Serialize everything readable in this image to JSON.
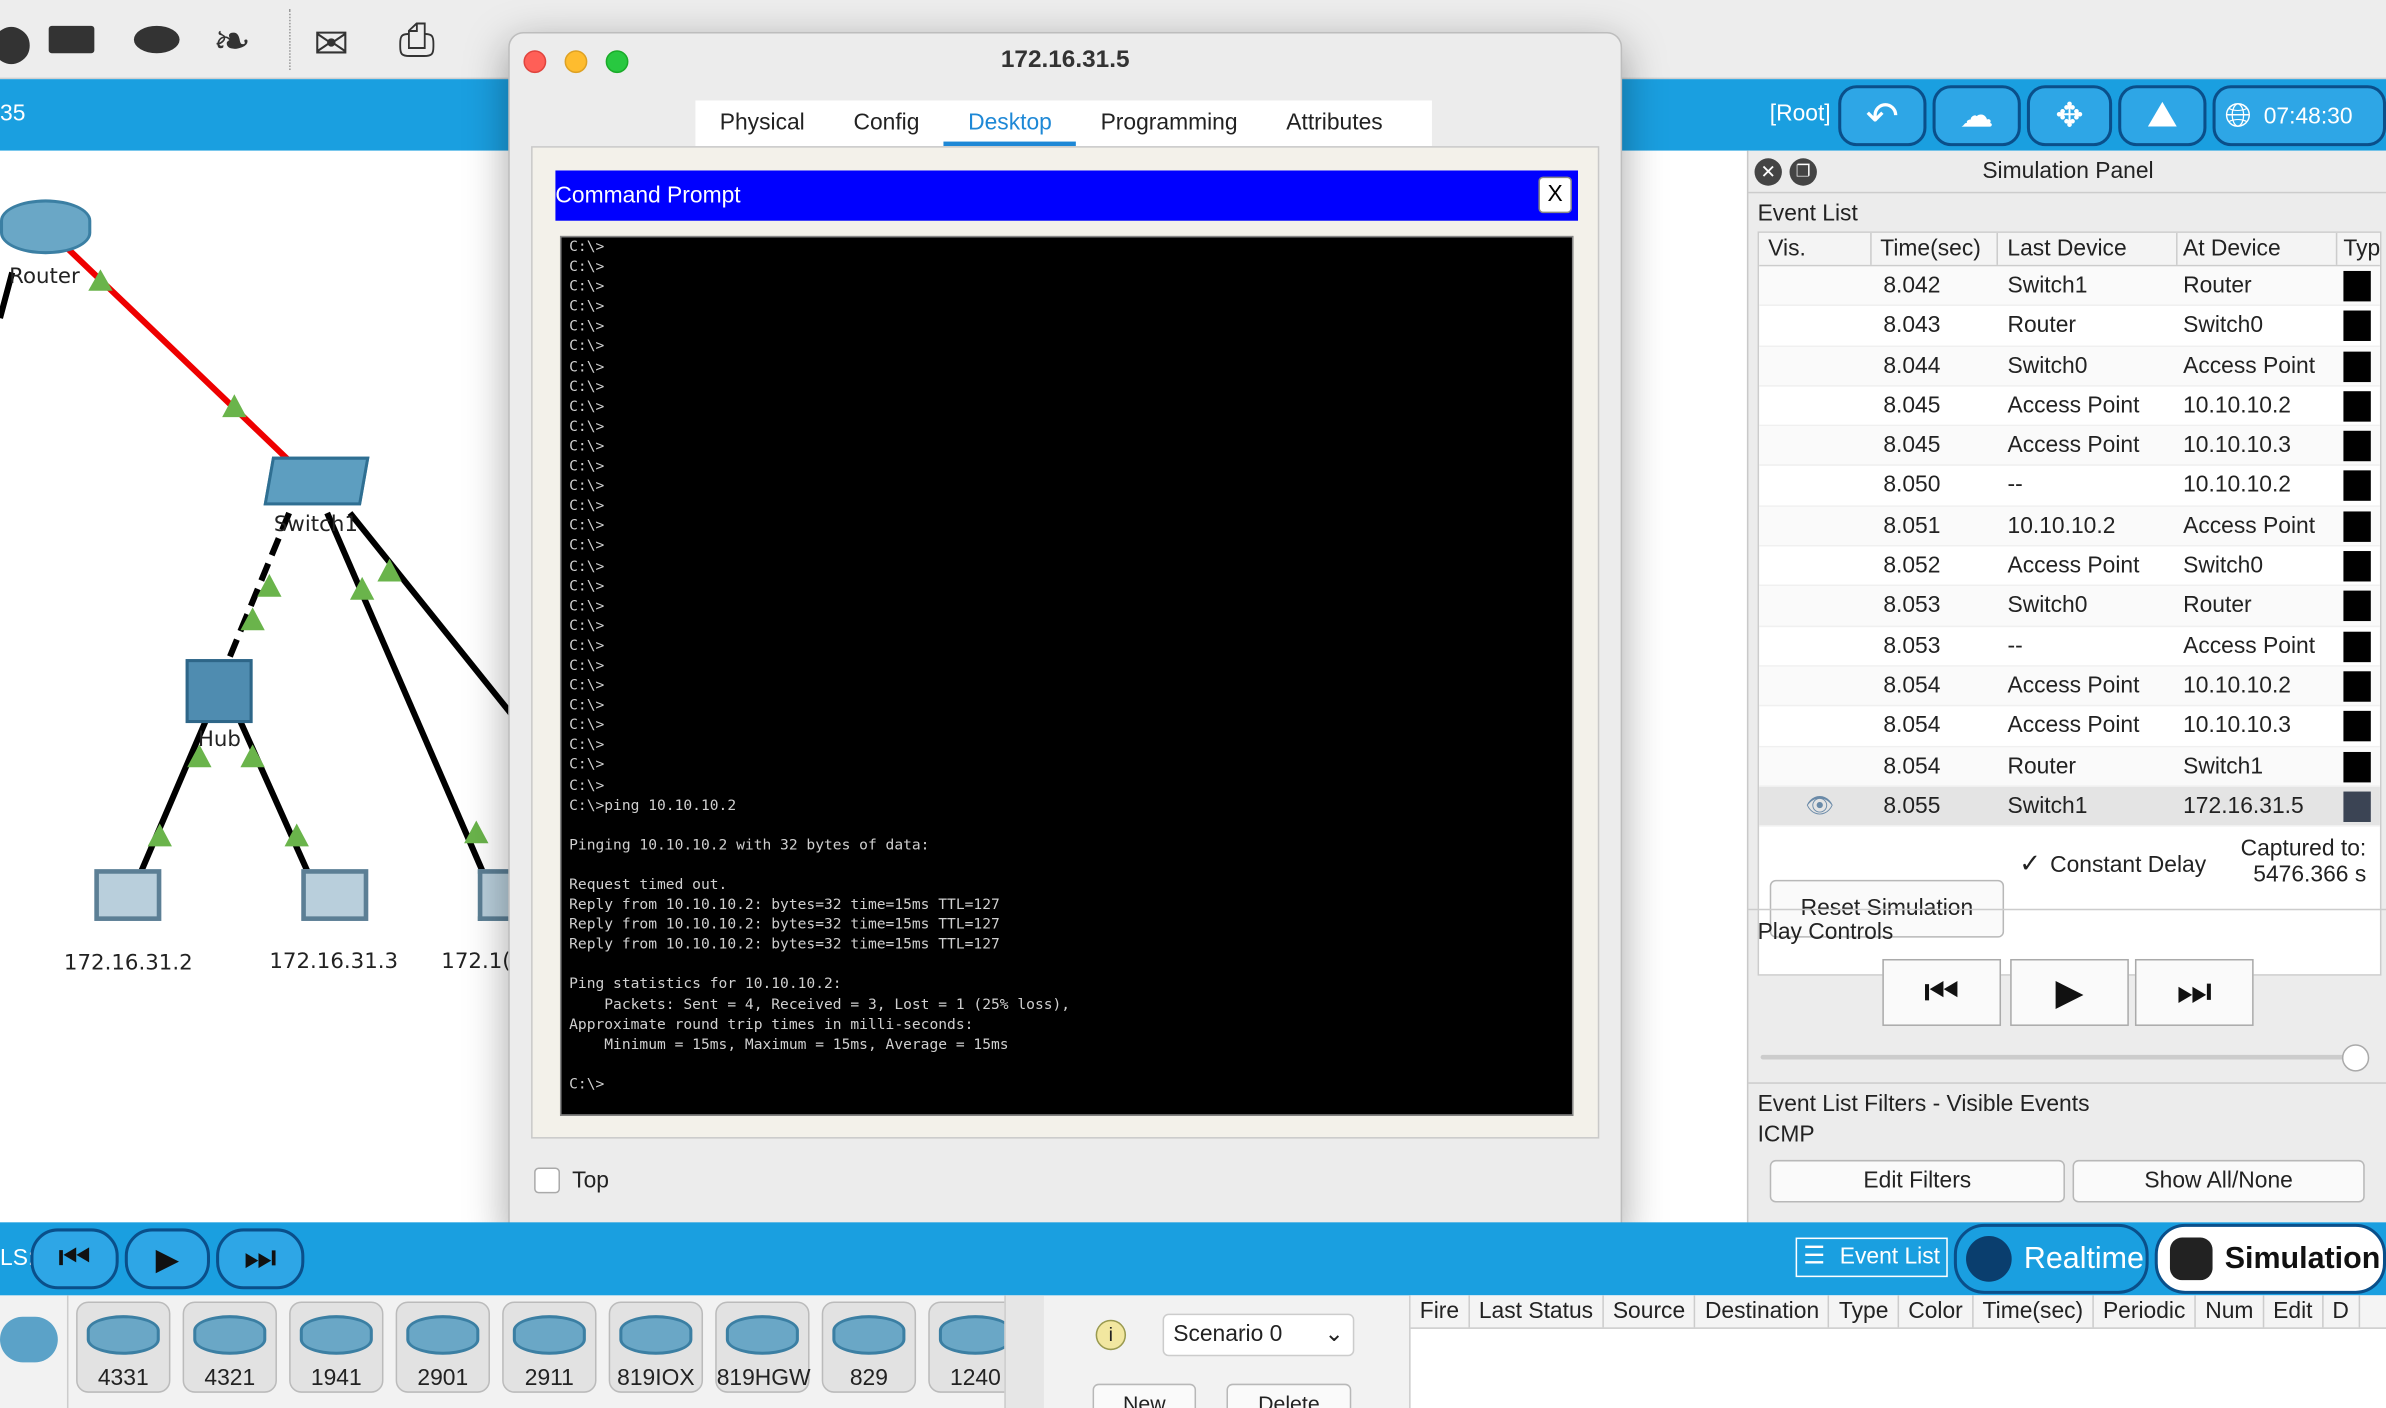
{
  "window": {
    "title": "172.16.31.5",
    "tabs": [
      "Physical",
      "Config",
      "Desktop",
      "Programming",
      "Attributes"
    ],
    "active_tab": "Desktop",
    "top_checkbox_label": "Top"
  },
  "command_prompt": {
    "title": "Command Prompt",
    "close": "X",
    "output": "C:\\>\nC:\\>\nC:\\>\nC:\\>\nC:\\>\nC:\\>\nC:\\>\nC:\\>\nC:\\>\nC:\\>\nC:\\>\nC:\\>\nC:\\>\nC:\\>\nC:\\>\nC:\\>\nC:\\>\nC:\\>\nC:\\>\nC:\\>\nC:\\>\nC:\\>\nC:\\>\nC:\\>\nC:\\>\nC:\\>\nC:\\>\nC:\\>\nC:\\>ping 10.10.10.2\n\nPinging 10.10.10.2 with 32 bytes of data:\n\nRequest timed out.\nReply from 10.10.10.2: bytes=32 time=15ms TTL=127\nReply from 10.10.10.2: bytes=32 time=15ms TTL=127\nReply from 10.10.10.2: bytes=32 time=15ms TTL=127\n\nPing statistics for 10.10.10.2:\n    Packets: Sent = 4, Received = 3, Lost = 1 (25% loss),\nApproximate round trip times in milli-seconds:\n    Minimum = 15ms, Maximum = 15ms, Average = 15ms\n\nC:\\>"
  },
  "bluebar": {
    "left_fragment": "35",
    "root_label": "[Root]",
    "clock": "07:48:30"
  },
  "topology": {
    "labels": {
      "router": "Router",
      "switch": "Switch1",
      "hub": "Hub",
      "pc1": "172.16.31.2",
      "pc2": "172.16.31.3",
      "pc3": "172.1("
    }
  },
  "sim_panel": {
    "title": "Simulation Panel",
    "event_list_label": "Event List",
    "columns": [
      "Vis.",
      "Time(sec)",
      "Last Device",
      "At Device",
      "Typ"
    ],
    "rows": [
      [
        "8.042",
        "Switch1",
        "Router"
      ],
      [
        "8.043",
        "Router",
        "Switch0"
      ],
      [
        "8.044",
        "Switch0",
        "Access Point"
      ],
      [
        "8.045",
        "Access Point",
        "10.10.10.2"
      ],
      [
        "8.045",
        "Access Point",
        "10.10.10.3"
      ],
      [
        "8.050",
        "--",
        "10.10.10.2"
      ],
      [
        "8.051",
        "10.10.10.2",
        "Access Point"
      ],
      [
        "8.052",
        "Access Point",
        "Switch0"
      ],
      [
        "8.053",
        "Switch0",
        "Router"
      ],
      [
        "8.053",
        "--",
        "Access Point"
      ],
      [
        "8.054",
        "Access Point",
        "10.10.10.2"
      ],
      [
        "8.054",
        "Access Point",
        "10.10.10.3"
      ],
      [
        "8.054",
        "Router",
        "Switch1"
      ],
      [
        "8.055",
        "Switch1",
        "172.16.31.5"
      ]
    ],
    "reset_button": "Reset Simulation",
    "constant_delay": "Constant Delay",
    "captured_label": "Captured to:",
    "captured_value": "5476.366 s",
    "play_controls": "Play Controls",
    "filters_label": "Event List Filters - Visible Events",
    "filter_value": "ICMP",
    "edit_filters": "Edit Filters",
    "show_all": "Show All/None"
  },
  "bottom": {
    "left_fragment": "LS:",
    "event_list_btn": "Event List",
    "realtime": "Realtime",
    "simulation": "Simulation",
    "devices": [
      "4331",
      "4321",
      "1941",
      "2901",
      "2911",
      "819IOX",
      "819HGW",
      "829",
      "1240"
    ],
    "scenario": "Scenario 0",
    "new_btn": "New",
    "delete_btn": "Delete",
    "pdu_columns": [
      "Fire",
      "Last Status",
      "Source",
      "Destination",
      "Type",
      "Color",
      "Time(sec)",
      "Periodic",
      "Num",
      "Edit",
      "D"
    ]
  }
}
